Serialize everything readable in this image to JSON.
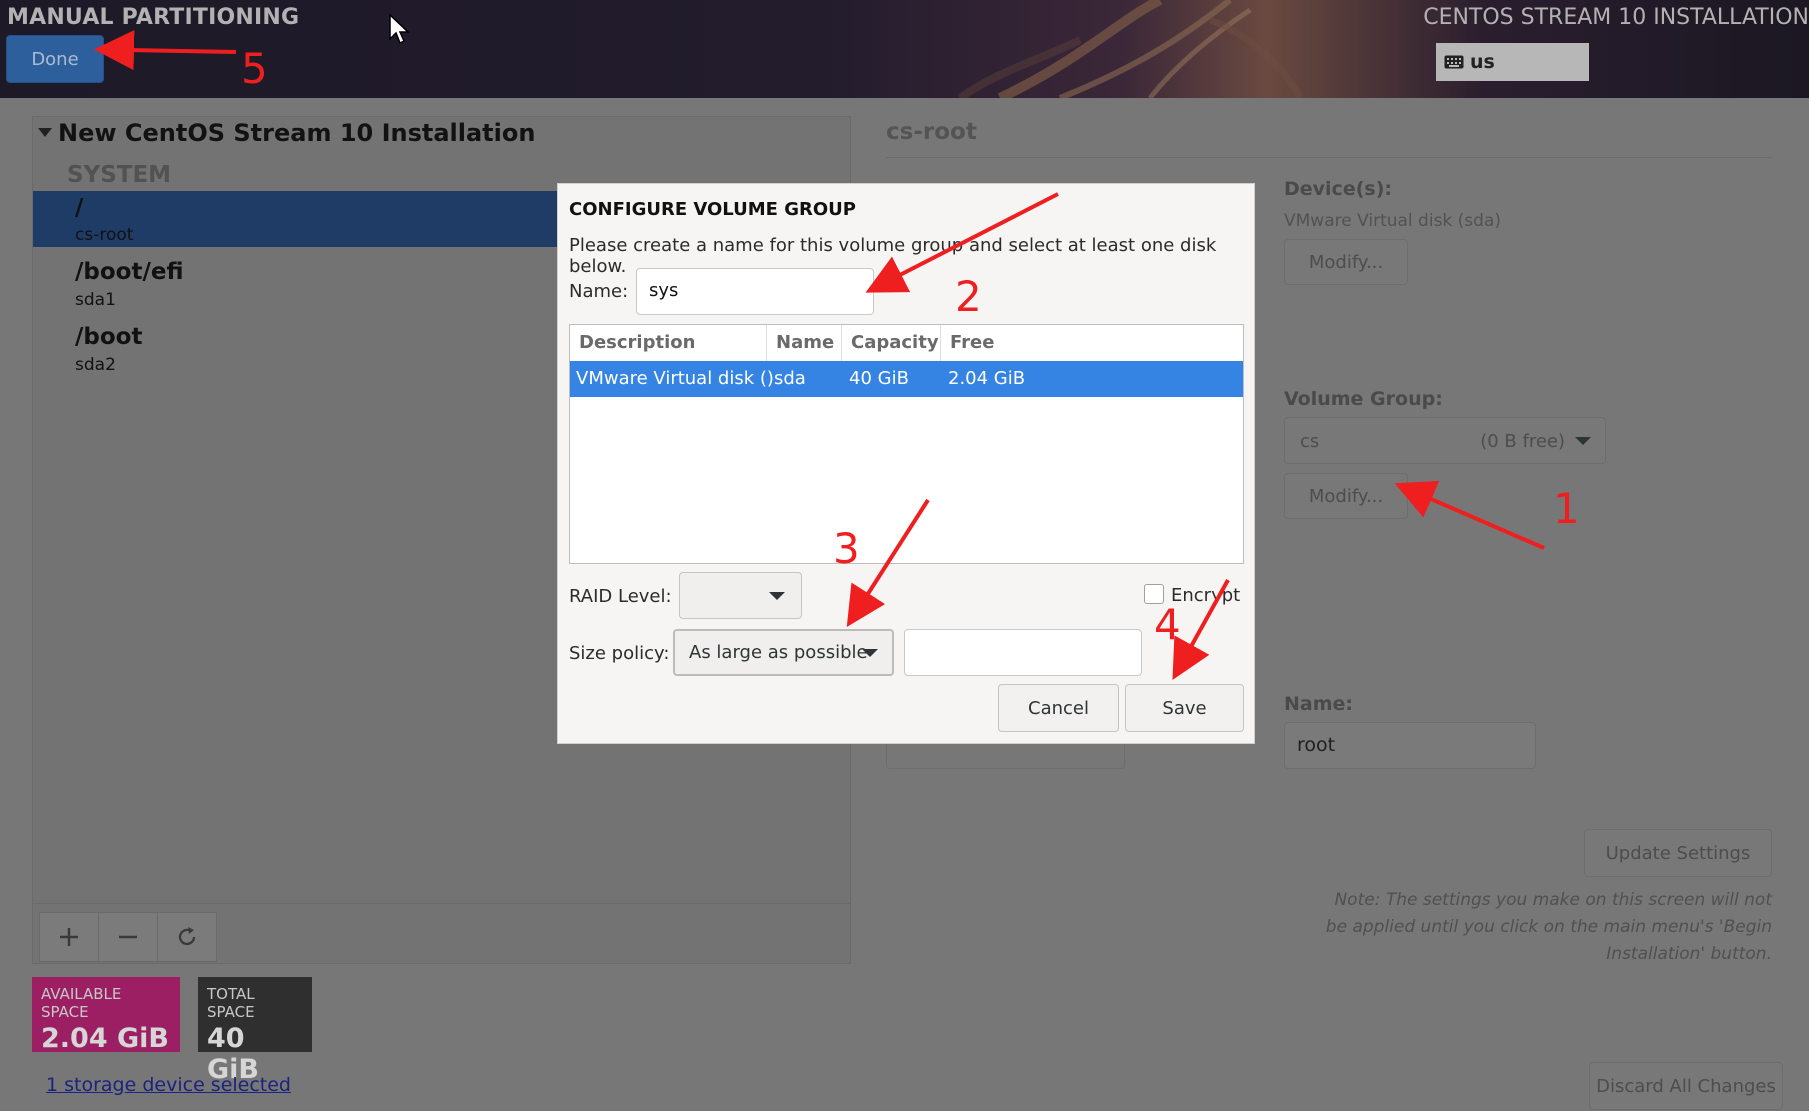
{
  "header": {
    "title": "MANUAL PARTITIONING",
    "done_label": "Done",
    "installer_title": "CENTOS STREAM 10 INSTALLATION",
    "keyboard_layout": "us"
  },
  "left": {
    "install_title": "New CentOS Stream 10 Installation",
    "section": "SYSTEM",
    "mounts": [
      {
        "name": "/",
        "device": "cs-root"
      },
      {
        "name": "/boot/efi",
        "device": "sda1"
      },
      {
        "name": "/boot",
        "device": "sda2"
      }
    ],
    "available_label": "AVAILABLE SPACE",
    "available_value": "2.04 GiB",
    "total_label": "TOTAL SPACE",
    "total_value": "40 GiB",
    "storage_link": "1 storage device selected",
    "colors": {
      "available_bg": "#9b1f62",
      "total_bg": "#2f2f2f",
      "selected_bg": "#1f3c66"
    }
  },
  "right": {
    "title": "cs-root",
    "devices_label": "Device(s):",
    "devices_value": "VMware Virtual disk (sda)",
    "modify_label": "Modify...",
    "vg_label": "Volume Group:",
    "vg_value": "cs",
    "vg_free": "(0 B free)",
    "vg_modify_label": "Modify...",
    "name_label": "Name:",
    "name_value": "root",
    "update_label": "Update Settings",
    "note": "Note:  The settings you make on this screen will not be applied until you click on the main menu's 'Begin Installation' button.",
    "discard_label": "Discard All Changes"
  },
  "dialog": {
    "title": "CONFIGURE VOLUME GROUP",
    "subtitle": "Please create a name for this volume group and select at least one disk below.",
    "name_label": "Name:",
    "name_value": "sys",
    "columns": [
      "Description",
      "Name",
      "Capacity",
      "Free"
    ],
    "rows": [
      {
        "description": "VMware Virtual disk ()",
        "name": "sda",
        "capacity": "40 GiB",
        "free": "2.04 GiB"
      }
    ],
    "raid_label": "RAID Level:",
    "raid_value": "",
    "encrypt_label": "Encrypt",
    "size_policy_label": "Size policy:",
    "size_policy_value": "As large as possible",
    "size_value": "",
    "cancel_label": "Cancel",
    "save_label": "Save",
    "accent": "#3584e4"
  },
  "annotations": {
    "numbers": [
      "1",
      "2",
      "3",
      "4",
      "5"
    ],
    "color": "#f01f1f"
  }
}
